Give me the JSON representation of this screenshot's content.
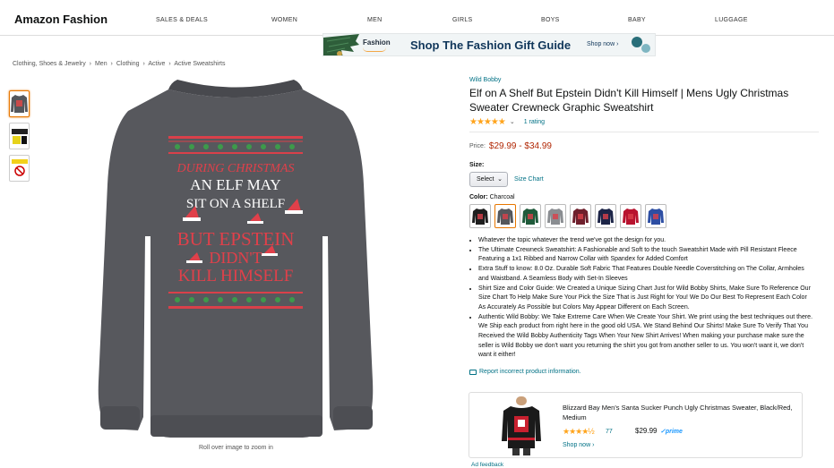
{
  "nav": {
    "brand": "Amazon Fashion",
    "items": [
      "SALES & DEALS",
      "WOMEN",
      "MEN",
      "GIRLS",
      "BOYS",
      "BABY",
      "LUGGAGE"
    ]
  },
  "banner": {
    "logo": "Fashion",
    "headline": "Shop The Fashion Gift Guide",
    "cta": "Shop now ›"
  },
  "breadcrumb": [
    "Clothing, Shoes & Jewelry",
    "›",
    "Men",
    "›",
    "Clothing",
    "›",
    "Active",
    "›",
    "Active Sweatshirts"
  ],
  "image": {
    "zoom_hint": "Roll over image to zoom in",
    "print_lines": [
      "DURING CHRISTMAS",
      "AN ELF MAY",
      "SIT ON A SHELF",
      "BUT EPSTEIN",
      "DIDN'T",
      "KILL HIMSELF"
    ]
  },
  "product": {
    "brand": "Wild Bobby",
    "title": "Elf on A Shelf But Epstein Didn't Kill Himself | Mens Ugly Christmas Sweater Crewneck Graphic Sweatshirt",
    "stars": "★★★★★",
    "rating_text": "1 rating",
    "price_label": "Price:",
    "price": "$29.99 - $34.99",
    "size_label": "Size:",
    "size_select": "Select",
    "size_chart": "Size Chart",
    "color_label": "Color:",
    "color_value": "Charcoal",
    "swatch_colors": [
      "#1e1e1e",
      "#55575c",
      "#1f5a3a",
      "#8a8d91",
      "#6e1f2c",
      "#1c2447",
      "#b8132f",
      "#2d4ea3"
    ],
    "bullets": [
      "Whatever the topic whatever the trend we've got the design for you.",
      "The Ultimate Crewneck Sweatshirt: A Fashionable and Soft to the touch Sweatshirt Made with Pill Resistant Fleece Featuring a 1x1 Ribbed and Narrow Collar with Spandex for Added Comfort",
      "Extra Stuff to know: 8.0 Oz. Durable Soft Fabric That Features Double Needle Coverstitching on The Collar, Armholes and Waistband. A Seamless Body with Set-In Sleeves",
      "Shirt Size and Color Guide: We Created a Unique Sizing Chart Just for Wild Bobby Shirts, Make Sure To Reference Our Size Chart To Help Make Sure Your Pick the Size That is Just Right for You! We Do Our Best To Represent Each Color As Accurately As Possible but Colors May Appear Different on Each Screen.",
      "Authentic Wild Bobby: We Take Extreme Care When We Create Your Shirt. We print using the best techniques out there. We Ship each product from right here in the good old USA. We Stand Behind Our Shirts! Make Sure To Verify That You Received the Wild Bobby Authenticity Tags When Your New Shirt Arrives! When making your purchase make sure the seller is Wild Bobby we don't want you returning the shirt you got from another seller to us. You won't want it, we don't want it either!"
    ],
    "report": "Report incorrect product information."
  },
  "ad": {
    "title": "Blizzard Bay Men's Santa Sucker Punch Ugly Christmas Sweater, Black/Red, Medium",
    "stars": "★★★★½",
    "count": "77",
    "price": "$29.99",
    "prime": "✓prime",
    "shop": "Shop now ›",
    "feedback": "Ad feedback"
  }
}
